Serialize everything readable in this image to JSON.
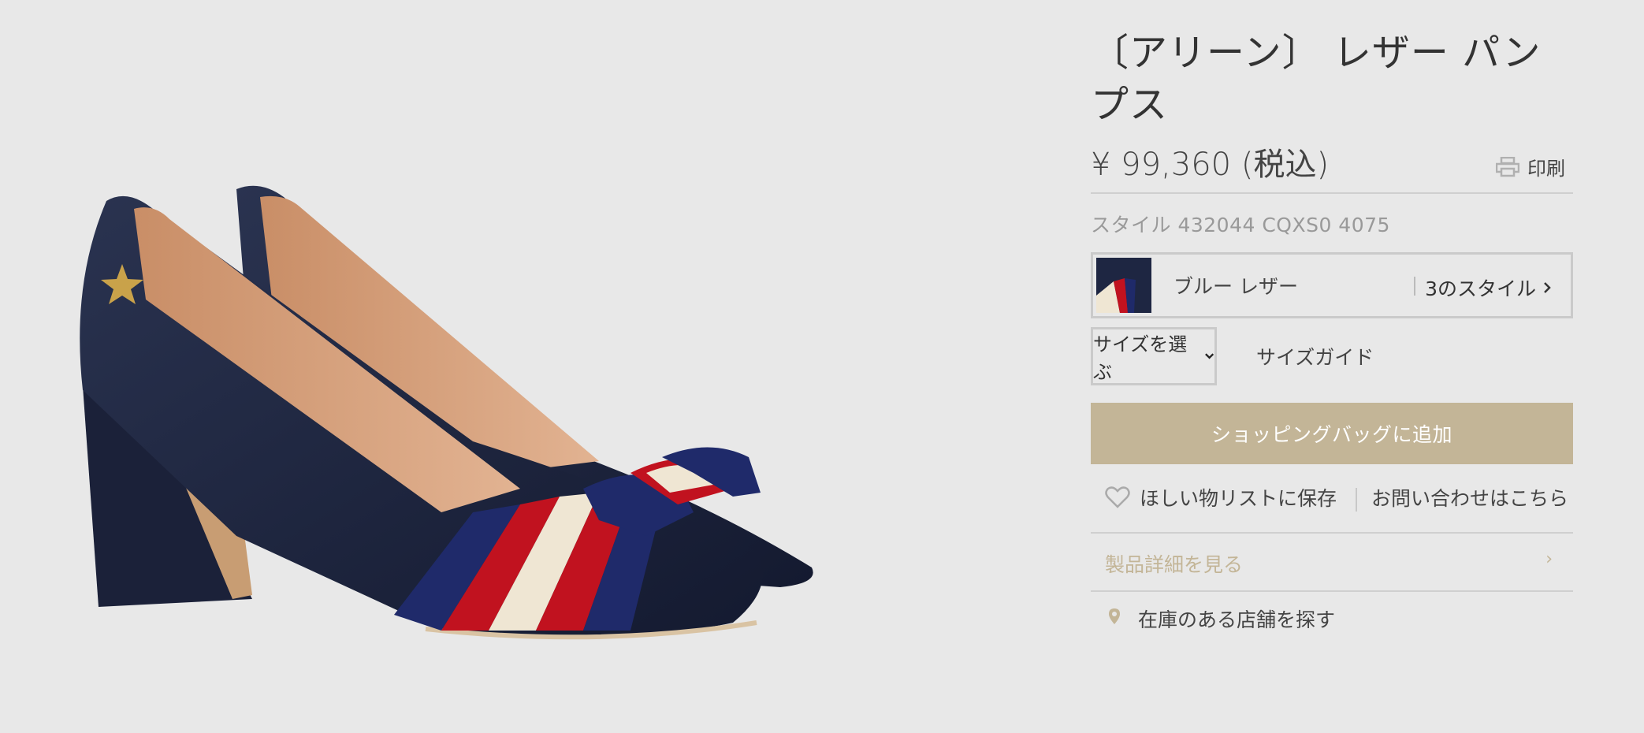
{
  "product": {
    "title": "〔アリーン〕 レザー パンプス",
    "price": "¥ 99,360 (税込)",
    "style_number": "スタイル 432044 CQXS0 4075"
  },
  "print": {
    "label": "印刷",
    "icon": "printer-icon"
  },
  "variant": {
    "color_name": "ブルー レザー",
    "styles_label": "3のスタイル",
    "icon": "chevron-right-icon"
  },
  "size": {
    "select_label": "サイズを選ぶ",
    "guide_label": "サイズガイド",
    "icon": "chevron-down-icon"
  },
  "actions": {
    "add_to_bag": "ショッピングバッグに追加",
    "wishlist": "ほしい物リストに保存",
    "contact": "お問い合わせはこちら"
  },
  "details": {
    "label": "製品詳細を見る",
    "chevron": "›"
  },
  "store": {
    "label": "在庫のある店舗を探す",
    "icon": "location-pin-icon"
  },
  "colors": {
    "background": "#e8e8e8",
    "accent_gold": "#c3b597",
    "navy": "#1e2642",
    "web_red": "#c1121f"
  }
}
